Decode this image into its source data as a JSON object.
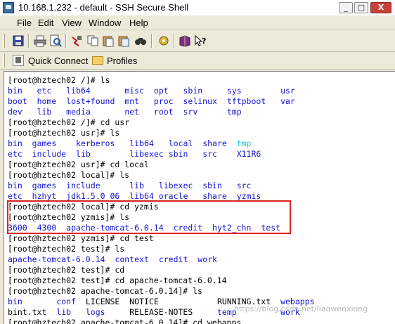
{
  "window": {
    "title": "10.168.1.232 - default - SSH Secure Shell",
    "minimize": "_",
    "maximize": "□",
    "close": "X"
  },
  "menu": [
    "File",
    "Edit",
    "View",
    "Window",
    "Help"
  ],
  "toolbar": {
    "icons": [
      "save-icon",
      "print-icon",
      "print-preview-icon",
      "disconnect-icon",
      "copy-icon",
      "paste-icon",
      "paste-file-icon",
      "find-icon",
      "settings-icon",
      "help-book-icon",
      "whats-this-icon"
    ]
  },
  "quickbar": {
    "quick_connect": "Quick Connect",
    "profiles": "Profiles"
  },
  "terminal": {
    "colors": {
      "prompt": "#000000",
      "dir": "#1414d2",
      "tmp": "#17c8e0"
    },
    "lines": [
      [
        {
          "t": "[root@hztech02 /]# ls",
          "c": "black"
        }
      ],
      [
        {
          "t": "bin",
          "c": "blue",
          "col": 0
        },
        {
          "t": "etc",
          "c": "blue",
          "col": 6
        },
        {
          "t": "lib64",
          "c": "blue",
          "col": 12
        },
        {
          "t": "misc",
          "c": "blue",
          "col": 24
        },
        {
          "t": "opt",
          "c": "blue",
          "col": 30
        },
        {
          "t": "sbin",
          "c": "blue",
          "col": 36
        },
        {
          "t": "sys",
          "c": "blue",
          "col": 45
        },
        {
          "t": "usr",
          "c": "blue",
          "col": 56
        }
      ],
      [
        {
          "t": "boot",
          "c": "blue",
          "col": 0
        },
        {
          "t": "home",
          "c": "blue",
          "col": 6
        },
        {
          "t": "lost+found",
          "c": "blue",
          "col": 12
        },
        {
          "t": "mnt",
          "c": "blue",
          "col": 24
        },
        {
          "t": "proc",
          "c": "blue",
          "col": 30
        },
        {
          "t": "selinux",
          "c": "blue",
          "col": 36
        },
        {
          "t": "tftpboot",
          "c": "blue",
          "col": 45
        },
        {
          "t": "var",
          "c": "blue",
          "col": 56
        }
      ],
      [
        {
          "t": "dev",
          "c": "blue",
          "col": 0
        },
        {
          "t": "lib",
          "c": "blue",
          "col": 6
        },
        {
          "t": "media",
          "c": "blue",
          "col": 12
        },
        {
          "t": "net",
          "c": "blue",
          "col": 24
        },
        {
          "t": "root",
          "c": "blue",
          "col": 30
        },
        {
          "t": "srv",
          "c": "blue",
          "col": 36
        },
        {
          "t": "tmp",
          "c": "blue",
          "col": 45
        }
      ],
      [
        {
          "t": "[root@hztech02 /]# cd usr",
          "c": "black"
        }
      ],
      [
        {
          "t": "[root@hztech02 usr]# ls",
          "c": "black"
        }
      ],
      [
        {
          "t": "bin",
          "c": "blue",
          "col": 0
        },
        {
          "t": "games",
          "c": "blue",
          "col": 5
        },
        {
          "t": "kerberos",
          "c": "blue",
          "col": 14
        },
        {
          "t": "lib64",
          "c": "blue",
          "col": 25
        },
        {
          "t": "local",
          "c": "blue",
          "col": 33
        },
        {
          "t": "share",
          "c": "blue",
          "col": 40
        },
        {
          "t": "tmp",
          "c": "cyan",
          "col": 47
        }
      ],
      [
        {
          "t": "etc",
          "c": "blue",
          "col": 0
        },
        {
          "t": "include",
          "c": "blue",
          "col": 5
        },
        {
          "t": "lib",
          "c": "blue",
          "col": 14
        },
        {
          "t": "libexec",
          "c": "blue",
          "col": 25
        },
        {
          "t": "sbin",
          "c": "blue",
          "col": 33
        },
        {
          "t": "src",
          "c": "blue",
          "col": 40
        },
        {
          "t": "X11R6",
          "c": "blue",
          "col": 47
        }
      ],
      [
        {
          "t": "[root@hztech02 usr]# cd local",
          "c": "black"
        }
      ],
      [
        {
          "t": "[root@hztech02 local]# ls",
          "c": "black"
        }
      ],
      [
        {
          "t": "bin",
          "c": "blue",
          "col": 0
        },
        {
          "t": "games",
          "c": "blue",
          "col": 5
        },
        {
          "t": "include",
          "c": "blue",
          "col": 12
        },
        {
          "t": "lib",
          "c": "blue",
          "col": 25
        },
        {
          "t": "libexec",
          "c": "blue",
          "col": 31
        },
        {
          "t": "sbin",
          "c": "blue",
          "col": 40
        },
        {
          "t": "src",
          "c": "blue",
          "col": 47
        }
      ],
      [
        {
          "t": "etc",
          "c": "blue",
          "col": 0
        },
        {
          "t": "hzhyt",
          "c": "blue",
          "col": 5
        },
        {
          "t": "jdk1.5.0_06",
          "c": "blue",
          "col": 12
        },
        {
          "t": "lib64",
          "c": "blue",
          "col": 25
        },
        {
          "t": "oracle",
          "c": "blue",
          "col": 31
        },
        {
          "t": "share",
          "c": "blue",
          "col": 40
        },
        {
          "t": "yzmis",
          "c": "blue",
          "col": 47
        }
      ],
      [
        {
          "t": "[root@hztech02 local]# cd yzmis",
          "c": "black"
        }
      ],
      [
        {
          "t": "[root@hztech02 yzmis]# ls",
          "c": "black"
        }
      ],
      [
        {
          "t": "3600",
          "c": "blue",
          "col": 0
        },
        {
          "t": "4300",
          "c": "blue",
          "col": 6
        },
        {
          "t": "apache-tomcat-6.0.14",
          "c": "blue",
          "col": 12
        },
        {
          "t": "credit",
          "c": "blue",
          "col": 34
        },
        {
          "t": "hyt2_chn",
          "c": "blue",
          "col": 42
        },
        {
          "t": "test",
          "c": "blue",
          "col": 52
        }
      ],
      [
        {
          "t": "[root@hztech02 yzmis]# cd test",
          "c": "black"
        }
      ],
      [
        {
          "t": "[root@hztech02 test]# ls",
          "c": "black"
        }
      ],
      [
        {
          "t": "apache-tomcat-6.0.14",
          "c": "blue",
          "col": 0
        },
        {
          "t": "context",
          "c": "blue",
          "col": 22
        },
        {
          "t": "credit",
          "c": "blue",
          "col": 31
        },
        {
          "t": "work",
          "c": "blue",
          "col": 39
        }
      ],
      [
        {
          "t": "[root@hztech02 test]# cd",
          "c": "black"
        }
      ],
      [
        {
          "t": "[root@hztech02 test]# cd apache-tomcat-6.0.14",
          "c": "black"
        }
      ],
      [
        {
          "t": "[root@hztech02 apache-tomcat-6.0.14]# ls",
          "c": "black"
        }
      ],
      [
        {
          "t": "bin",
          "c": "blue",
          "col": 0
        },
        {
          "t": "conf",
          "c": "blue",
          "col": 10
        },
        {
          "t": "LICENSE",
          "c": "black",
          "col": 16
        },
        {
          "t": "NOTICE",
          "c": "black",
          "col": 25
        },
        {
          "t": "RUNNING.txt",
          "c": "black",
          "col": 43
        },
        {
          "t": "webapps",
          "c": "blue",
          "col": 56
        }
      ],
      [
        {
          "t": "bint.txt",
          "c": "black",
          "col": 0
        },
        {
          "t": "lib",
          "c": "blue",
          "col": 10
        },
        {
          "t": "logs",
          "c": "blue",
          "col": 16
        },
        {
          "t": "RELEASE-NOTES",
          "c": "black",
          "col": 25
        },
        {
          "t": "temp",
          "c": "blue",
          "col": 43
        },
        {
          "t": "work",
          "c": "blue",
          "col": 56
        }
      ],
      [
        {
          "t": "[root@hztech02 apache-tomcat-6.0.14]# cd webapps",
          "c": "black"
        }
      ]
    ]
  },
  "watermark": "https://blog.csdn.net/liaowenxiong"
}
